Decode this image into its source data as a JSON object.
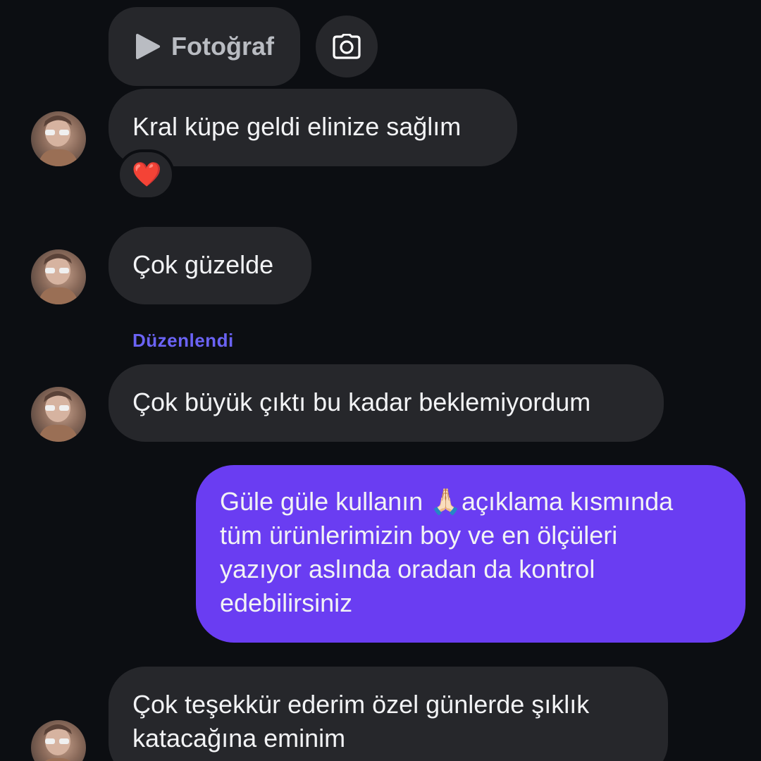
{
  "media_message": {
    "label": "Fotoğraf",
    "play_icon": "play-icon",
    "camera_icon": "camera-icon"
  },
  "messages": [
    {
      "id": "m1",
      "direction": "incoming",
      "text": "Kral küpe geldi elinize sağlım",
      "reaction": "❤️"
    },
    {
      "id": "m2",
      "direction": "incoming",
      "text": "Çok güzelde"
    },
    {
      "id": "m3",
      "direction": "incoming",
      "edited_label": "Düzenlendi",
      "text": "Çok büyük çıktı bu kadar beklemiyordum"
    },
    {
      "id": "m4",
      "direction": "outgoing",
      "lines": [
        "Güle güle kullanın 🙏🏻açıklama kısmında",
        "tüm ürünlerimizin boy ve en ölçüleri",
        "yazıyor aslında oradan da kontrol",
        "edebilirsiniz"
      ]
    },
    {
      "id": "m5",
      "direction": "incoming",
      "lines": [
        "Çok teşekkür ederim özel günlerde şıklık",
        "katacağına eminim"
      ]
    }
  ],
  "colors": {
    "background": "#0c0e12",
    "incoming_bubble": "#26272b",
    "outgoing_bubble": "#6a3df2",
    "edited_label": "#6b63f5"
  }
}
